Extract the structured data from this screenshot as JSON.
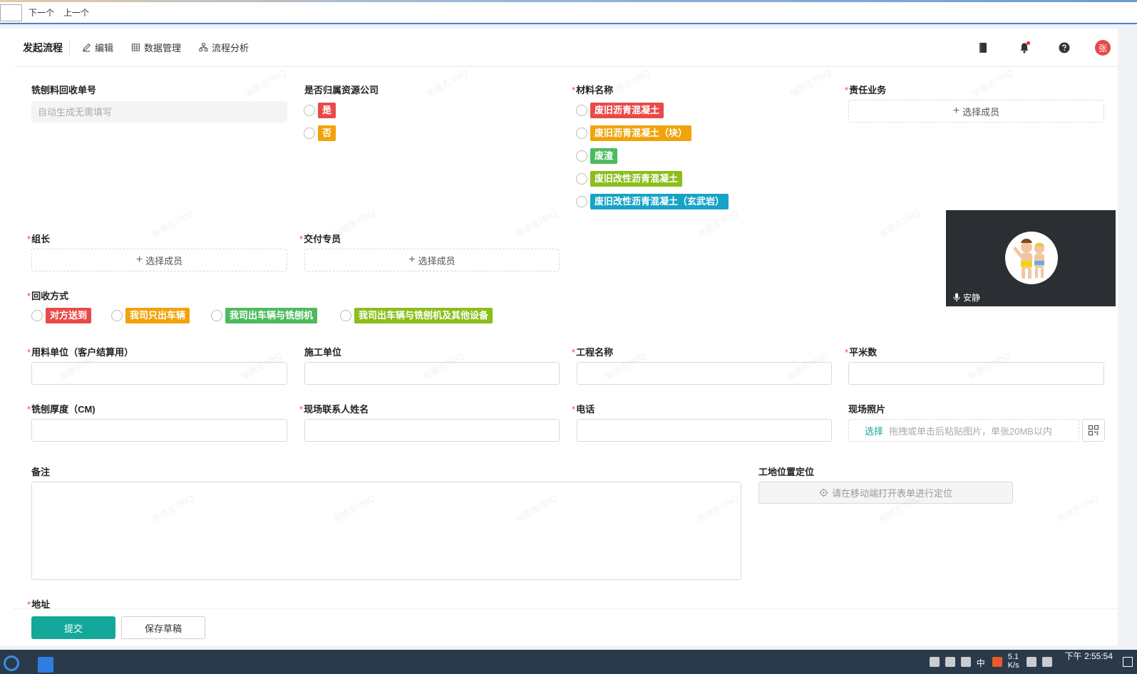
{
  "findbar": {
    "next_label": "下一个",
    "prev_label": "上一个"
  },
  "header": {
    "title": "发起流程",
    "nav": [
      {
        "label": "编辑",
        "icon": "edit-icon"
      },
      {
        "label": "数据管理",
        "icon": "table-icon"
      },
      {
        "label": "流程分析",
        "icon": "flow-icon"
      }
    ],
    "avatar_text": "张"
  },
  "form": {
    "order_no": {
      "label": "铣刨料回收单号",
      "placeholder": "自动生成无需填写"
    },
    "belong": {
      "label": "是否归属资源公司",
      "options": [
        {
          "text": "是",
          "color": "#e84a4a"
        },
        {
          "text": "否",
          "color": "#f0a30a"
        }
      ]
    },
    "material": {
      "label": "材料名称",
      "options": [
        {
          "text": "废旧沥青混凝土",
          "color": "#e84a4a"
        },
        {
          "text": "废旧沥青混凝土（块）",
          "color": "#f0a30a"
        },
        {
          "text": "废渣",
          "color": "#4cbb5e"
        },
        {
          "text": "废旧改性沥青混凝土",
          "color": "#8bbe1b"
        },
        {
          "text": "废旧改性沥青混凝土（玄武岩）",
          "color": "#17a3c8"
        }
      ]
    },
    "duty": {
      "label": "责任业务",
      "button": "选择成员"
    },
    "leader": {
      "label": "组长",
      "button": "选择成员"
    },
    "delivery": {
      "label": "交付专员",
      "button": "选择成员"
    },
    "recycle": {
      "label": "回收方式",
      "options": [
        {
          "text": "对方送到",
          "color": "#e84a4a"
        },
        {
          "text": "我司只出车辆",
          "color": "#f0a30a"
        },
        {
          "text": "我司出车辆与铣刨机",
          "color": "#4cbb5e"
        },
        {
          "text": "我司出车辆与铣刨机及其他设备",
          "color": "#8bbe1b"
        }
      ]
    },
    "customer": {
      "label": "用料单位（客户结算用）"
    },
    "constructor": {
      "label": "施工单位"
    },
    "project": {
      "label": "工程名称"
    },
    "area": {
      "label": "平米数"
    },
    "thickness": {
      "label": "铣刨厚度（CM)"
    },
    "contact": {
      "label": "现场联系人姓名"
    },
    "phone": {
      "label": "电话"
    },
    "photo": {
      "label": "现场照片",
      "choose": "选择",
      "hint": "拖拽或单击后粘贴图片，单张20MB以内"
    },
    "remark": {
      "label": "备注"
    },
    "location": {
      "label": "工地位置定位",
      "button": "请在移动端打开表单进行定位"
    },
    "address": {
      "label": "地址"
    }
  },
  "footer": {
    "submit": "提交",
    "draft": "保存草稿"
  },
  "video": {
    "status": "安静"
  },
  "taskbar": {
    "lang": "中",
    "speed_value": "5.1",
    "speed_unit": "K/s",
    "time": "下午 2:55:54"
  },
  "watermark": "张德志7RtQ",
  "colors": {
    "accent": "#14a89a",
    "required": "#e84a4a"
  }
}
